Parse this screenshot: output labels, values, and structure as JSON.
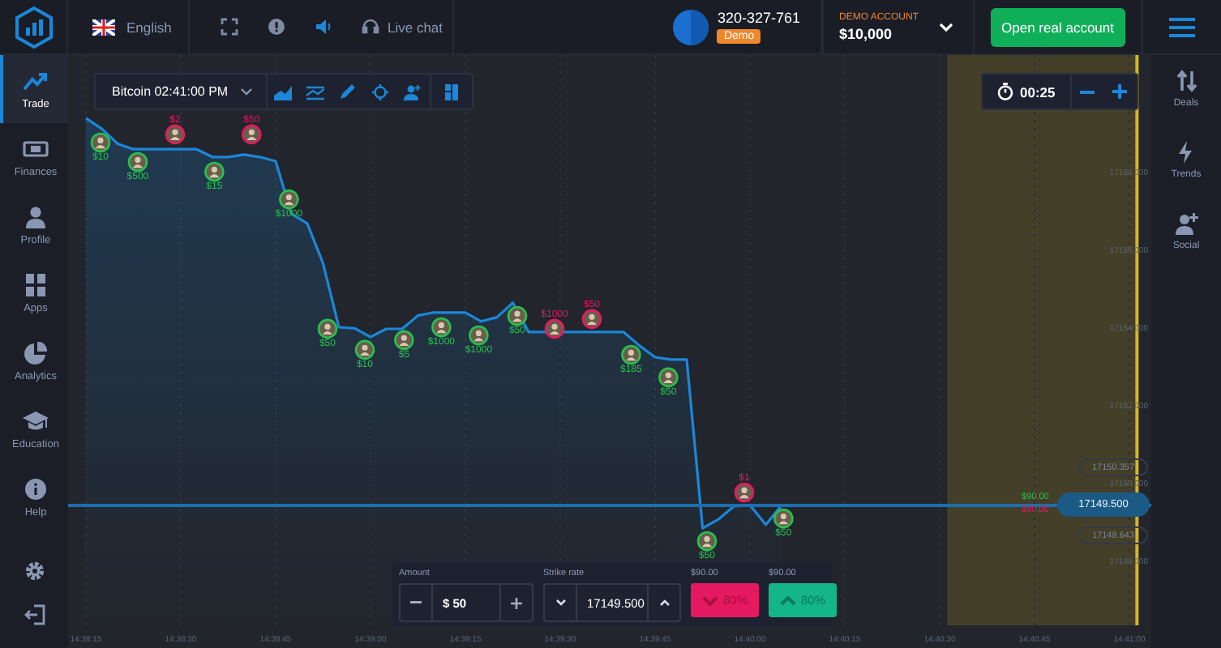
{
  "header": {
    "language": "English",
    "live_chat": "Live chat",
    "account_id": "320-327-761",
    "account_badge": "Demo",
    "account_type": "DEMO ACCOUNT",
    "balance": "$10,000",
    "open_account": "Open real account"
  },
  "sidebar": {
    "items": [
      {
        "label": "Trade",
        "kind": "trade",
        "selected": true
      },
      {
        "label": "Finances",
        "kind": "finances",
        "selected": false
      },
      {
        "label": "Profile",
        "kind": "profile",
        "selected": false
      },
      {
        "label": "Apps",
        "kind": "apps",
        "selected": false
      },
      {
        "label": "Analytics",
        "kind": "analytics",
        "selected": false
      },
      {
        "label": "Education",
        "kind": "education",
        "selected": false
      },
      {
        "label": "Help",
        "kind": "help",
        "selected": false
      }
    ]
  },
  "toolbar": {
    "asset": "Bitcoin 02:41:00 PM",
    "tools": [
      {
        "kind": "area"
      },
      {
        "kind": "indicators"
      },
      {
        "kind": "draw"
      },
      {
        "kind": "crosshair"
      },
      {
        "kind": "social"
      },
      {
        "kind": "layout"
      }
    ]
  },
  "timer": {
    "time": "00:25"
  },
  "right_sidebar": {
    "items": [
      {
        "label": "Deals",
        "kind": "deals"
      },
      {
        "label": "Trends",
        "kind": "trends"
      },
      {
        "label": "Social",
        "kind": "social"
      }
    ]
  },
  "chart": {
    "price_label": "17149.500",
    "upper_label": "17150.357",
    "lower_label": "17148.643",
    "up_payout": "$90.00",
    "down_payout": "$90.00",
    "chart_data": {
      "type": "line",
      "categories": [
        "14:38:15",
        null,
        null,
        null,
        null,
        null,
        "14:38:30",
        null,
        null,
        null,
        null,
        null,
        "14:38:45",
        null,
        null,
        null,
        null,
        null,
        "14:39:00",
        null,
        null,
        null,
        null,
        null,
        "14:39:15",
        null,
        null,
        null,
        null,
        null,
        "14:39:30",
        null,
        null,
        null,
        null,
        null,
        "14:39:45",
        null,
        null,
        null,
        null,
        null,
        "14:40:00",
        null,
        null,
        null,
        null,
        null,
        "14:40:15",
        null,
        null,
        null,
        null,
        null,
        "14:40:30",
        null,
        null,
        null,
        null,
        null,
        "14:40:45",
        null,
        null,
        null,
        null,
        null,
        "14:41:00"
      ],
      "series": [
        {
          "color": "#1b87d9",
          "values": [
            17159.38,
            17159.11,
            17158.72,
            17158.58,
            17158.58,
            17158.58,
            17158.58,
            17158.58,
            17158.38,
            17158.38,
            17158.44,
            17158.38,
            17158.27,
            17156.92,
            17156.67,
            17155.65,
            17154.0,
            17153.97,
            17153.75,
            17153.96,
            17153.96,
            17154.3,
            17154.38,
            17154.38,
            17154.38,
            17154.15,
            17154.26,
            17154.63,
            17153.88,
            17153.88,
            17153.88,
            17153.88,
            17153.88,
            17153.88,
            17153.88,
            17153.53,
            17153.23,
            17153.17,
            17153.17,
            17148.83,
            17149.06,
            17149.4,
            17149.42,
            17148.92,
            17149.42,
            null,
            null,
            null,
            null,
            null,
            null,
            null,
            null,
            null,
            null,
            null,
            null,
            null,
            null,
            null,
            null,
            null,
            null,
            null,
            null,
            null,
            null
          ]
        }
      ],
      "grid": true,
      "ylim": [
        17146.333,
        17161
      ],
      "yticks": [
        {
          "value": 17148,
          "label": "17148.000"
        },
        {
          "value": 17150,
          "label": "17150.000"
        },
        {
          "value": 17152,
          "label": "17152.000"
        },
        {
          "value": 17154,
          "label": "17154.000"
        },
        {
          "value": 17156,
          "label": "17156.000"
        },
        {
          "value": 17158,
          "label": "17158.000"
        }
      ]
    },
    "trades": [
      {
        "amount": "$10",
        "kind": "up"
      },
      {
        "amount": "$500",
        "kind": "up"
      },
      {
        "amount": "$2",
        "kind": "down"
      },
      {
        "amount": "$15",
        "kind": "up"
      },
      {
        "amount": "$50",
        "kind": "down"
      },
      {
        "amount": "$1000",
        "kind": "up"
      },
      {
        "amount": "$50",
        "kind": "up"
      },
      {
        "amount": "$10",
        "kind": "up"
      },
      {
        "amount": "$5",
        "kind": "up"
      },
      {
        "amount": "$1000",
        "kind": "up"
      },
      {
        "amount": "$1000",
        "kind": "up"
      },
      {
        "amount": "$50",
        "kind": "up"
      },
      {
        "amount": "$1000",
        "kind": "down"
      },
      {
        "amount": "$50",
        "kind": "down"
      },
      {
        "amount": "$185",
        "kind": "up"
      },
      {
        "amount": "$50",
        "kind": "up"
      },
      {
        "amount": "$50",
        "kind": "up"
      },
      {
        "amount": "$1",
        "kind": "down"
      },
      {
        "amount": "$50",
        "kind": "up"
      }
    ]
  },
  "trade_panel": {
    "amount_label": "Amount",
    "amount": "$ 50",
    "strike_label": "Strike rate",
    "strike": "17149.500",
    "down": {
      "payout": "$90.00",
      "percent": "80%"
    },
    "up": {
      "payout": "$90.00",
      "percent": "80%"
    }
  }
}
